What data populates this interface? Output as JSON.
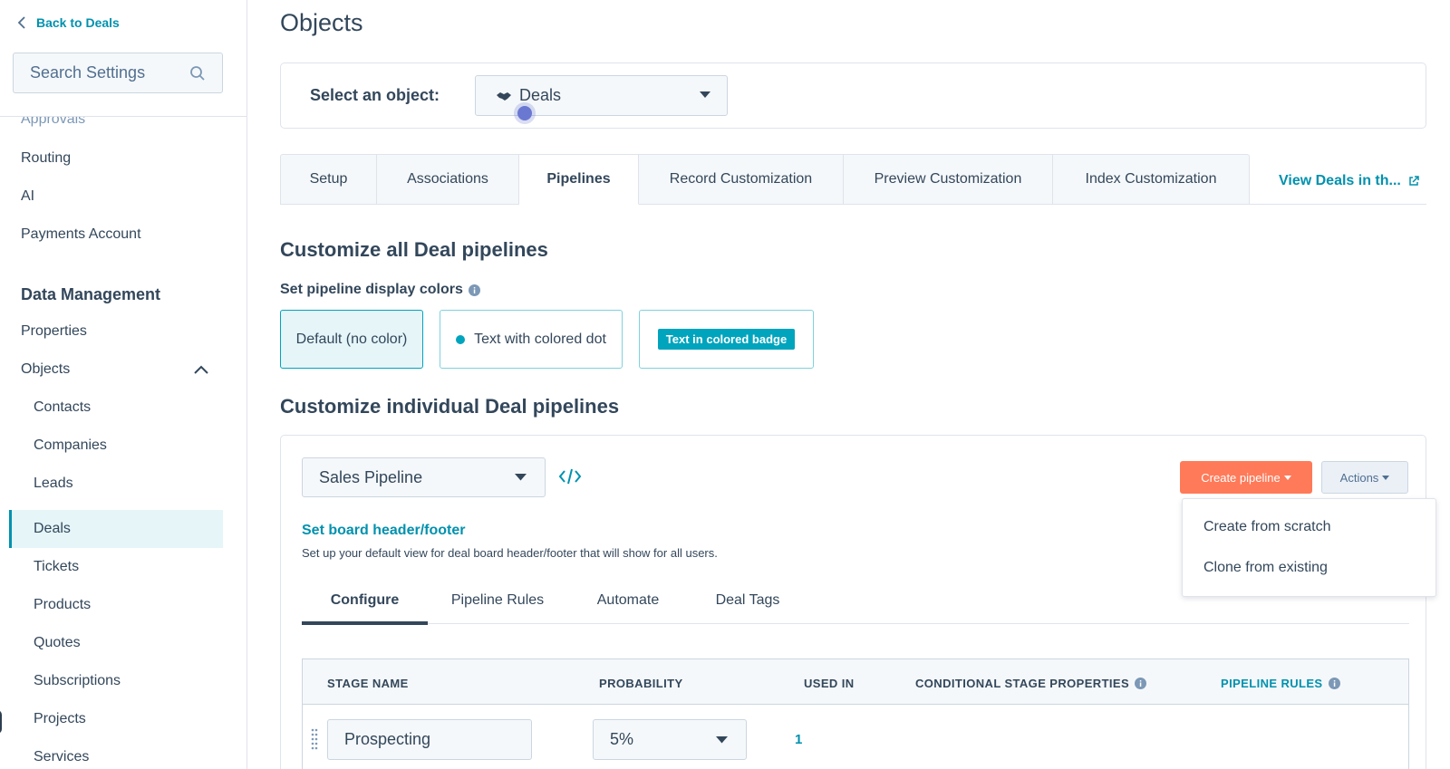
{
  "sidebar": {
    "back_label": "Back to Deals",
    "search_placeholder": "Search Settings",
    "items_top": [
      "Approvals",
      "Routing",
      "AI",
      "Payments Account"
    ],
    "section_heading": "Data Management",
    "items_section": [
      "Properties",
      "Objects"
    ],
    "object_children": [
      "Contacts",
      "Companies",
      "Leads",
      "Deals",
      "Tickets",
      "Products",
      "Quotes",
      "Subscriptions",
      "Projects",
      "Services"
    ],
    "active_item": "Deals"
  },
  "header": {
    "title": "Objects"
  },
  "object_selector": {
    "label": "Select an object:",
    "value": "Deals"
  },
  "tabs": [
    {
      "label": "Setup"
    },
    {
      "label": "Associations"
    },
    {
      "label": "Pipelines"
    },
    {
      "label": "Record Customization"
    },
    {
      "label": "Preview Customization"
    },
    {
      "label": "Index Customization"
    }
  ],
  "active_tab": "Pipelines",
  "view_link": "View Deals in th...",
  "customize_all": {
    "title": "Customize all Deal pipelines",
    "display_label": "Set pipeline display colors",
    "options": [
      "Default (no color)",
      "Text with colored dot",
      "Text in colored badge"
    ],
    "selected": "Default (no color)"
  },
  "customize_individual": {
    "title": "Customize individual Deal pipelines",
    "pipeline_value": "Sales Pipeline",
    "create_button": "Create pipeline",
    "actions_button": "Actions",
    "board_link": "Set board header/footer",
    "board_desc": "Set up your default view for deal board header/footer that will show for all users.",
    "sub_tabs": [
      "Configure",
      "Pipeline Rules",
      "Automate",
      "Deal Tags"
    ],
    "active_sub_tab": "Configure"
  },
  "table": {
    "headers": [
      "STAGE NAME",
      "PROBABILITY",
      "USED IN",
      "CONDITIONAL STAGE PROPERTIES",
      "PIPELINE RULES"
    ],
    "rows": [
      {
        "stage": "Prospecting",
        "probability": "5%",
        "used_in": "1"
      }
    ]
  },
  "dropdown": {
    "items": [
      "Create from scratch",
      "Clone from existing"
    ]
  },
  "colors": {
    "accent": "#0091ae",
    "primary_button": "#ff7a59",
    "text": "#33475b",
    "badge": "#00a4bd"
  },
  "icons": [
    "chevron-left-icon",
    "search-icon",
    "chevron-up-icon",
    "handshake-icon",
    "caret-down-icon",
    "external-link-icon",
    "info-icon",
    "code-icon",
    "drag-handle-icon"
  ]
}
